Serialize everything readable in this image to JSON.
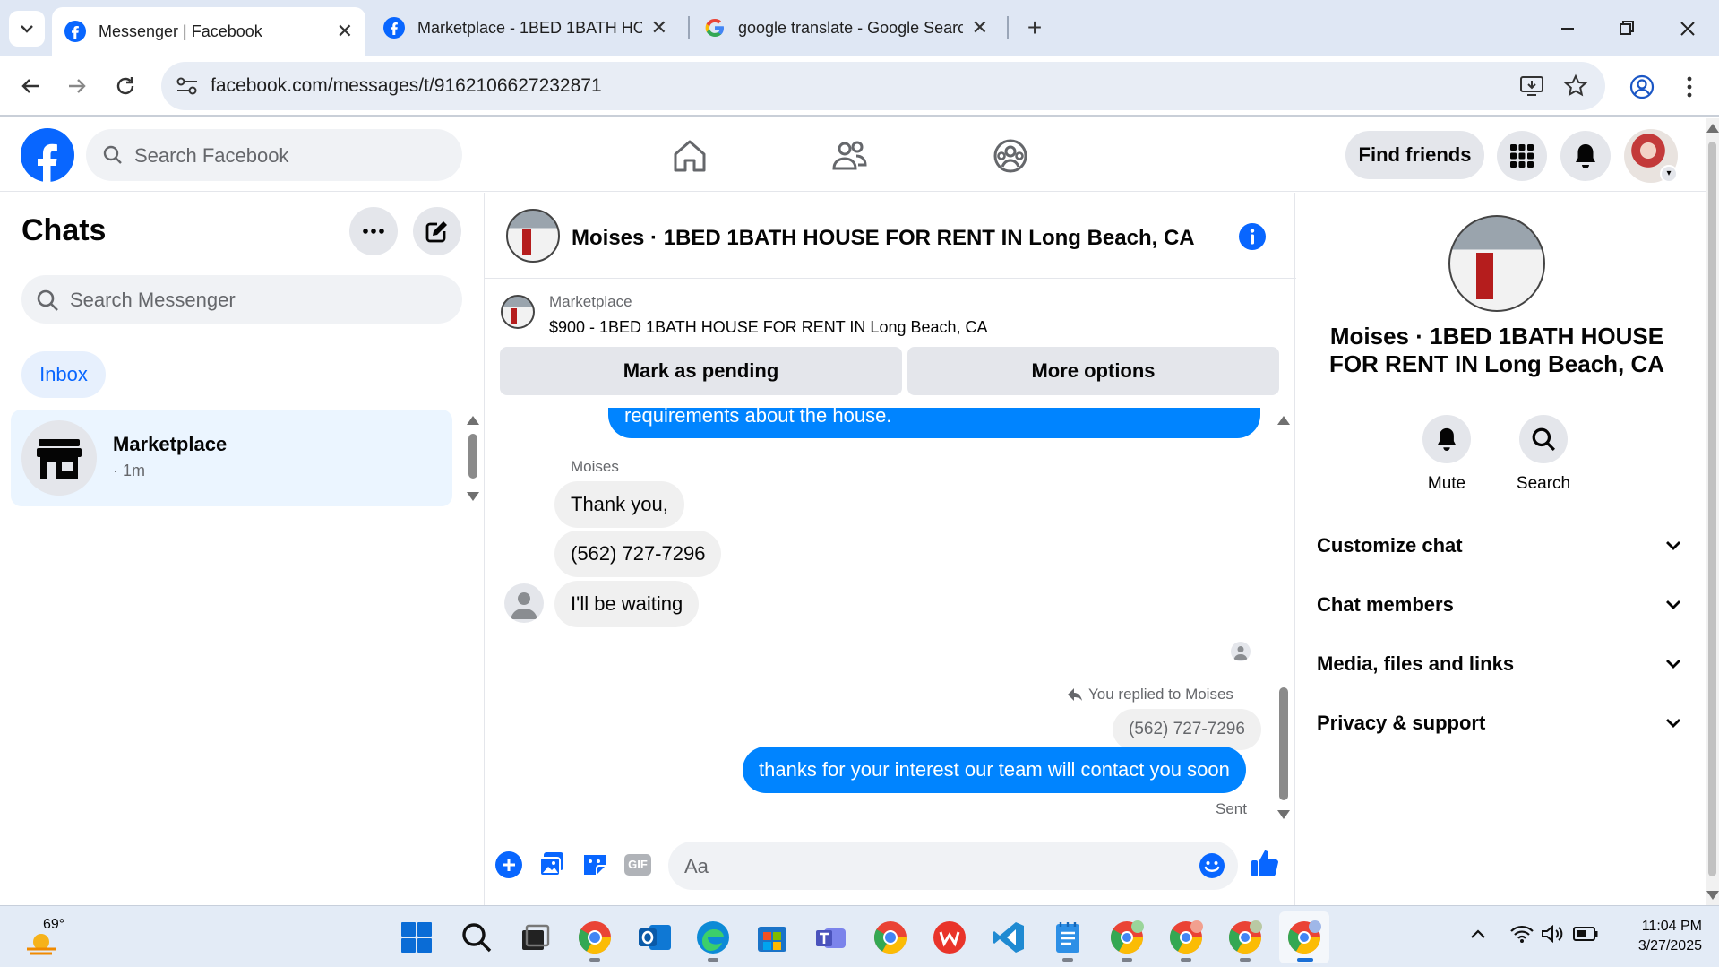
{
  "browser": {
    "tabs": [
      {
        "title": "Messenger | Facebook",
        "active": true
      },
      {
        "title": "Marketplace - 1BED 1BATH HO",
        "active": false
      },
      {
        "title": "google translate - Google Searc",
        "active": false
      }
    ],
    "url": "facebook.com/messages/t/9162106627232871"
  },
  "header": {
    "search_placeholder": "Search Facebook",
    "find_friends": "Find friends"
  },
  "sidebar": {
    "title": "Chats",
    "search_placeholder": "Search Messenger",
    "filter": "Inbox",
    "chats": [
      {
        "name": "Marketplace",
        "time": "· 1m"
      }
    ]
  },
  "conversation": {
    "title": "Moises · 1BED 1BATH HOUSE FOR RENT IN Long Beach, CA",
    "listing_label": "Marketplace",
    "listing_text": "$900 - 1BED 1BATH HOUSE FOR RENT IN Long Beach, CA",
    "buttons": {
      "pending": "Mark as pending",
      "more": "More options"
    },
    "partial_message": "requirements about the house.",
    "sender_name": "Moises",
    "incoming": [
      "Thank you,",
      "(562) 727-7296",
      "I'll be waiting"
    ],
    "reply_note": "You replied to Moises",
    "quoted": "(562) 727-7296",
    "outgoing": "thanks for your interest our team will contact you soon",
    "status": "Sent",
    "composer_placeholder": "Aa"
  },
  "info_panel": {
    "name": "Moises · 1BED 1BATH HOUSE FOR RENT IN Long Beach, CA",
    "actions": [
      "Mute",
      "Search"
    ],
    "sections": [
      "Customize chat",
      "Chat members",
      "Media, files and links",
      "Privacy & support"
    ]
  },
  "taskbar": {
    "weather": "69°",
    "time": "11:04 PM",
    "date": "3/27/2025"
  },
  "colors": {
    "brand": "#0866ff",
    "outgoing_bubble": "#0084ff",
    "active_chat": "#ebf5ff"
  }
}
